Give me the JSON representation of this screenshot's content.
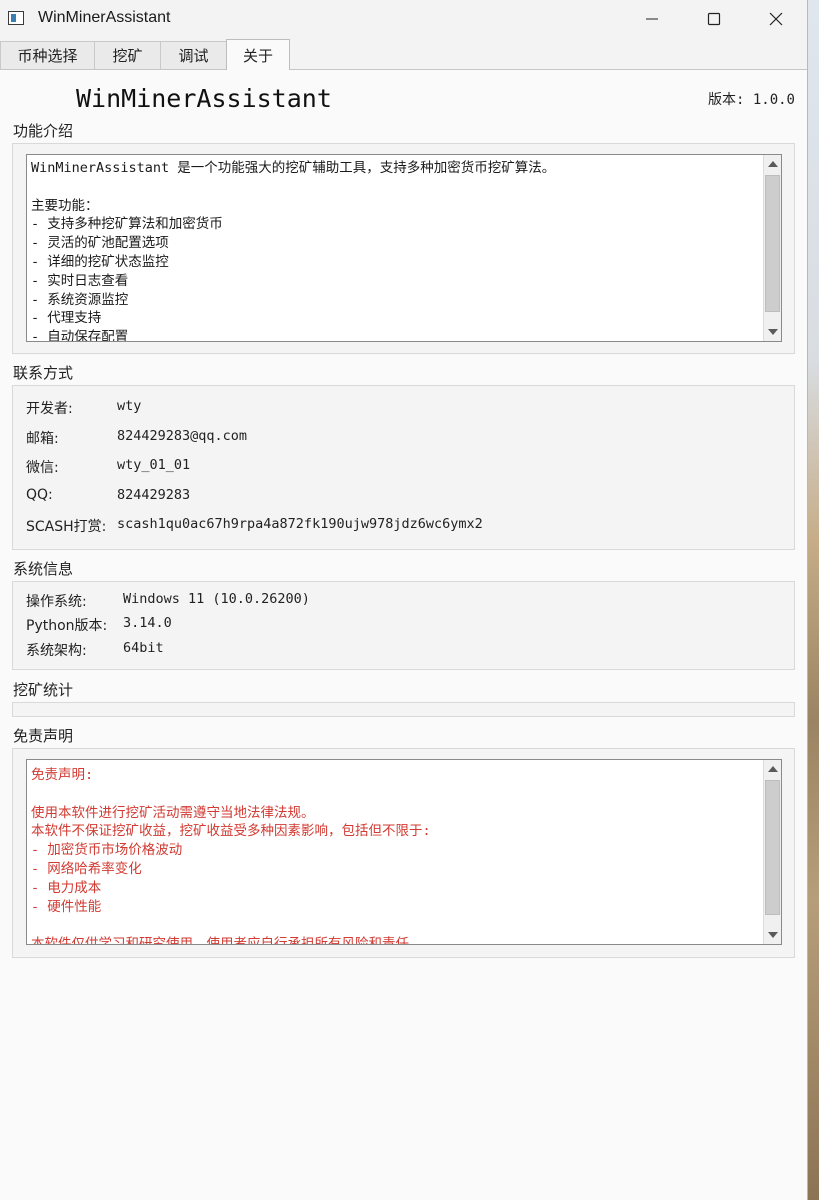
{
  "window": {
    "title": "WinMinerAssistant",
    "controls": {
      "minimize": "minimize-icon",
      "maximize": "maximize-icon",
      "close": "close-icon"
    }
  },
  "tabs": [
    {
      "label": "币种选择",
      "active": false
    },
    {
      "label": "挖矿",
      "active": false
    },
    {
      "label": "调试",
      "active": false
    },
    {
      "label": "关于",
      "active": true
    }
  ],
  "about": {
    "app_name": "WinMinerAssistant",
    "version": "版本: 1.0.0",
    "features": {
      "title": "功能介绍",
      "text": "WinMinerAssistant 是一个功能强大的挖矿辅助工具，支持多种加密货币挖矿算法。\n\n主要功能：\n- 支持多种挖矿算法和加密货币\n- 灵活的矿池配置选项\n- 详细的挖矿状态监控\n- 实时日志查看\n- 系统资源监控\n- 代理支持\n- 自动保存配置"
    },
    "contact": {
      "title": "联系方式",
      "rows": [
        {
          "label": "开发者:",
          "value": "wty"
        },
        {
          "label": "邮箱:",
          "value": "824429283@qq.com"
        },
        {
          "label": "微信:",
          "value": "wty_01_01"
        },
        {
          "label": "QQ:",
          "value": "824429283"
        },
        {
          "label": "SCASH打赏:",
          "value": "scash1qu0ac67h9rpa4a872fk190ujw978jdz6wc6ymx2"
        }
      ]
    },
    "system": {
      "title": "系统信息",
      "rows": [
        {
          "label": "操作系统:",
          "value": "Windows 11 (10.0.26200)"
        },
        {
          "label": "Python版本:",
          "value": "3.14.0"
        },
        {
          "label": "系统架构:",
          "value": "64bit"
        }
      ]
    },
    "stats": {
      "title": "挖矿统计"
    },
    "disclaimer": {
      "title": "免责声明",
      "text": "免责声明:\n\n使用本软件进行挖矿活动需遵守当地法律法规。\n本软件不保证挖矿收益，挖矿收益受多种因素影响，包括但不限于:\n- 加密货币市场价格波动\n- 网络哈希率变化\n- 电力成本\n- 硬件性能\n\n本软件仅供学习和研究使用，使用者应自行承担所有风险和责任。"
    }
  },
  "colors": {
    "disclaimer_text": "#d23a32",
    "window_bg": "#fafafa"
  }
}
